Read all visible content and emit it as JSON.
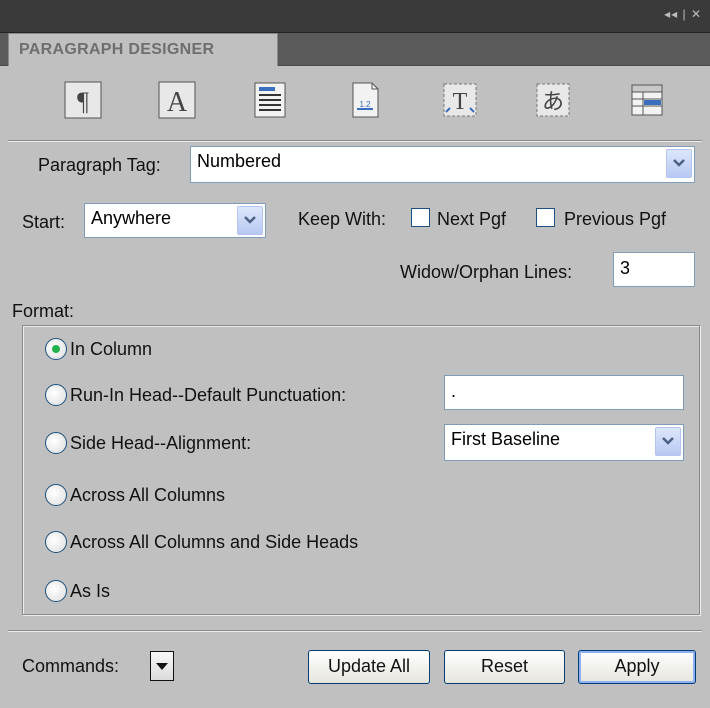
{
  "window": {
    "controls": "◂◂ | ✕"
  },
  "tab": {
    "title": "PARAGRAPH DESIGNER"
  },
  "toolbar": {
    "icons": [
      "pilcrow-icon",
      "character-a-icon",
      "pagination-icon",
      "numbering-icon",
      "advanced-text-icon",
      "asian-text-icon",
      "table-cell-icon"
    ]
  },
  "paragraph_tag": {
    "label": "Paragraph Tag:",
    "value": "Numbered"
  },
  "start": {
    "label": "Start:",
    "value": "Anywhere"
  },
  "keep_with": {
    "label": "Keep With:",
    "next_label": "Next Pgf",
    "next_checked": false,
    "previous_label": "Previous Pgf",
    "previous_checked": false
  },
  "widow_orphan": {
    "label": "Widow/Orphan Lines:",
    "value": "3"
  },
  "format": {
    "label": "Format:",
    "options": [
      {
        "label": "In Column",
        "selected": true
      },
      {
        "label": "Run-In Head--Default Punctuation:",
        "selected": false
      },
      {
        "label": "Side Head--Alignment:",
        "selected": false
      },
      {
        "label": "Across All Columns",
        "selected": false
      },
      {
        "label": "Across All Columns and Side Heads",
        "selected": false
      },
      {
        "label": "As Is",
        "selected": false
      }
    ],
    "punctuation_value": ".",
    "alignment_value": "First Baseline"
  },
  "footer": {
    "commands_label": "Commands:",
    "update_all": "Update All",
    "reset": "Reset",
    "apply": "Apply"
  },
  "colors": {
    "panel": "#c0c0c0",
    "titlebar": "#3a3a3a",
    "field_border": "#7f9db9",
    "radio_selected": "#23b14d"
  }
}
